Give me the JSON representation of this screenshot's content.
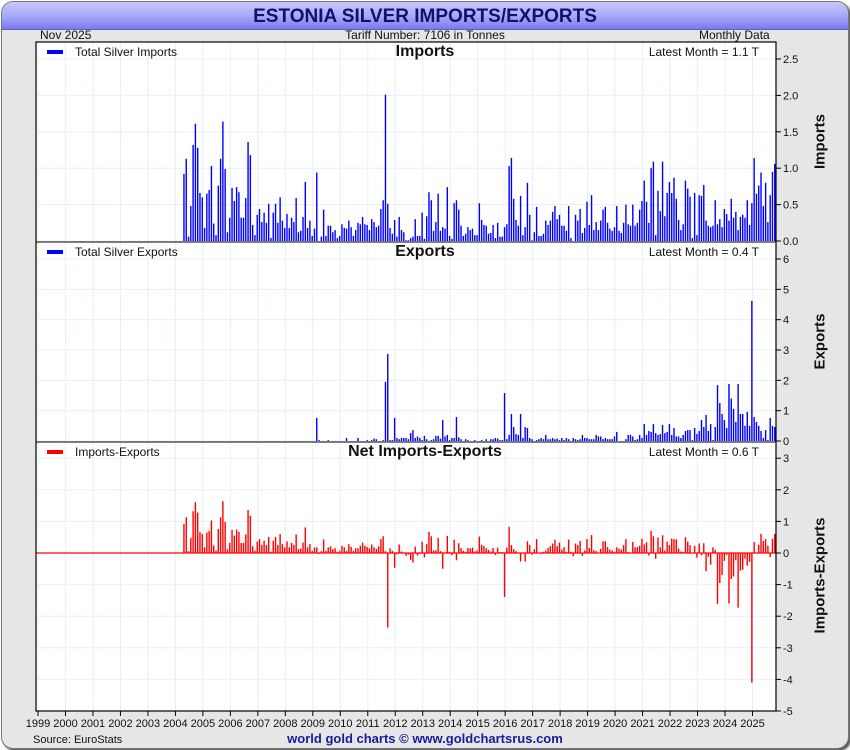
{
  "title": "ESTONIA SILVER IMPORTS/EXPORTS",
  "header": {
    "date": "Nov  2025",
    "tariff": "Tariff Number: 7106 in Tonnes",
    "frequency": "Monthly Data"
  },
  "footer": {
    "source": "Source: EuroStats",
    "brand": "world gold charts © www.goldchartsrus.com"
  },
  "colors": {
    "imports": "#0000ff",
    "exports": "#0000ff",
    "net": "#ff0000",
    "grid": "#e4f0fa"
  },
  "chart_data": {
    "type": "bar",
    "start_month": "2004-05",
    "end_month": "2025-11",
    "x_ticks": [
      "1999",
      "2000",
      "2001",
      "2002",
      "2003",
      "2004",
      "2005",
      "2006",
      "2007",
      "2008",
      "2009",
      "2010",
      "2011",
      "2012",
      "2013",
      "2014",
      "2015",
      "2016",
      "2017",
      "2018",
      "2019",
      "2020",
      "2021",
      "2022",
      "2023",
      "2024",
      "2025"
    ],
    "panels": [
      {
        "key": "imports",
        "title": "Imports",
        "ylabel": "Imports",
        "legend": "Total Silver Imports",
        "latest": "Latest Month = 1.1 T",
        "ylim": [
          0,
          2.5
        ],
        "yticks": [
          "0.0",
          "0.5",
          "1.0",
          "1.5",
          "2.0",
          "2.5"
        ],
        "tick_values": [
          0,
          0.5,
          1,
          1.5,
          2,
          2.5
        ]
      },
      {
        "key": "exports",
        "title": "Exports",
        "ylabel": "Exports",
        "legend": "Total Silver Exports",
        "latest": "Latest Month = 0.4 T",
        "ylim": [
          0,
          6
        ],
        "yticks": [
          "0",
          "1",
          "2",
          "3",
          "4",
          "5",
          "6"
        ],
        "tick_values": [
          0,
          1,
          2,
          3,
          4,
          5,
          6
        ]
      },
      {
        "key": "net",
        "title": "Net Imports-Exports",
        "ylabel": "Imports-Exports",
        "legend": "Imports-Exports",
        "latest": "Latest Month = 0.6 T",
        "ylim": [
          -5,
          3
        ],
        "yticks": [
          "-5",
          "-4",
          "-3",
          "-2",
          "-1",
          "0",
          "1",
          "2",
          "3"
        ],
        "tick_values": [
          -5,
          -4,
          -3,
          -2,
          -1,
          0,
          1,
          2,
          3
        ]
      }
    ],
    "series": {
      "imports": [
        0.92,
        1.13,
        0.06,
        0.48,
        1.32,
        1.61,
        1.28,
        0.66,
        0.6,
        0.18,
        0.65,
        0.7,
        1.03,
        0.24,
        0.08,
        0.76,
        1.13,
        1.64,
        0.99,
        0.12,
        0.32,
        0.73,
        0.55,
        0.74,
        0.67,
        0.32,
        0.32,
        0.59,
        1.36,
        1.18,
        0.22,
        0.08,
        0.36,
        0.44,
        0.26,
        0.39,
        0.25,
        0.51,
        0.04,
        0.39,
        0.51,
        0.25,
        0.6,
        0.28,
        0.18,
        0.37,
        0.18,
        0.32,
        0.26,
        0.59,
        0.12,
        0.14,
        0.33,
        0.81,
        0.18,
        0.28,
        0.07,
        0.17,
        0.94,
        0,
        0.06,
        0.43,
        0.07,
        0.21,
        0.21,
        0.12,
        0.15,
        0.04,
        0.07,
        0.23,
        0.18,
        0.17,
        0.28,
        0.19,
        0.07,
        0.15,
        0.25,
        0.23,
        0.33,
        0.23,
        0.22,
        0.15,
        0.3,
        0.26,
        0.19,
        0.21,
        0.44,
        0.56,
        2.01,
        0.51,
        0.18,
        0.1,
        0.29,
        0.06,
        0.33,
        0.15,
        0.12,
        0.01,
        0.01,
        0.04,
        0.06,
        0.3,
        0.07,
        0.07,
        0.39,
        0.03,
        0.34,
        0.67,
        0.56,
        0.14,
        0.26,
        0.65,
        0.14,
        0.19,
        0.17,
        0.74,
        0.07,
        0.03,
        0.52,
        0.56,
        0.43,
        0.21,
        0.07,
        0.1,
        0.19,
        0.15,
        0.17,
        0.08,
        0.08,
        0.52,
        0.29,
        0.22,
        0.21,
        0.1,
        0.11,
        0.22,
        0.04,
        0.25,
        0.06,
        0.06,
        0.19,
        0.23,
        1.03,
        1.14,
        0.58,
        0.29,
        0.21,
        0.62,
        0.08,
        0.19,
        0.8,
        0.36,
        0.01,
        0.12,
        0.47,
        0.07,
        0.07,
        0.1,
        0.28,
        0.22,
        0.28,
        0.4,
        0.48,
        0.3,
        0.36,
        0.21,
        0.21,
        0.14,
        0.48,
        0.04,
        0,
        0.36,
        0.28,
        0.44,
        0.11,
        0.18,
        0.54,
        0.22,
        0.63,
        0.15,
        0.26,
        0.15,
        0.28,
        0.43,
        0.47,
        0.25,
        0.17,
        0.14,
        0.19,
        0.48,
        0.14,
        0.11,
        0.25,
        0.5,
        0.23,
        0.21,
        0.5,
        0.21,
        0.25,
        0.43,
        0.55,
        0.83,
        0.54,
        0.25,
        1.0,
        1.09,
        0.08,
        0.69,
        0.41,
        1.09,
        0.34,
        0.66,
        0.81,
        0.66,
        0.87,
        0.58,
        0.29,
        0.15,
        0.23,
        0.83,
        0.72,
        0.61,
        0.04,
        0.66,
        0.08,
        0.63,
        0.62,
        0.77,
        0.28,
        0.21,
        0.19,
        0.21,
        0.56,
        0.23,
        0.3,
        0.19,
        0.44,
        0.37,
        0.28,
        0.58,
        0.32,
        0.4,
        0.15,
        0.33,
        0.36,
        0.32,
        0.56,
        0.22,
        0.52,
        1.14,
        0.65,
        0.76,
        0.94,
        0.48,
        0.8,
        0.26,
        0.63,
        0.95,
        1.06
      ],
      "exports": [
        0,
        0,
        0,
        0,
        0,
        0,
        0,
        0,
        0,
        0,
        0,
        0,
        0,
        0,
        0,
        0,
        0,
        0,
        0,
        0,
        0,
        0,
        0,
        0,
        0,
        0,
        0,
        0,
        0,
        0,
        0,
        0,
        0,
        0,
        0,
        0,
        0,
        0,
        0,
        0,
        0,
        0,
        0,
        0,
        0,
        0,
        0,
        0,
        0,
        0,
        0,
        0,
        0,
        0,
        0,
        0,
        0,
        0,
        0.76,
        0.03,
        0,
        0,
        0,
        0.03,
        0,
        0,
        0,
        0,
        0,
        0,
        0,
        0.1,
        0,
        0,
        0,
        0,
        0.1,
        0,
        0,
        0,
        0.03,
        0,
        0.03,
        0.08,
        0.06,
        0,
        0,
        0.03,
        1.95,
        2.87,
        0.03,
        0.03,
        0.76,
        0.1,
        0.06,
        0.1,
        0.1,
        0.1,
        0.06,
        0.26,
        0.36,
        0.1,
        0.15,
        0.1,
        0.03,
        0.17,
        0.06,
        0,
        0.03,
        0.06,
        0.17,
        0.17,
        0.08,
        0.69,
        0.15,
        0.2,
        0.03,
        0.1,
        0.1,
        0.79,
        0.12,
        0.06,
        0,
        0.06,
        0.03,
        0,
        0,
        0.03,
        0,
        0,
        0.03,
        0,
        0.06,
        0,
        0.06,
        0.06,
        0.1,
        0.08,
        0.03,
        0.03,
        1.58,
        0.06,
        0.2,
        0.89,
        0.46,
        0.23,
        0.2,
        0.89,
        0.1,
        0.46,
        0.43,
        0.1,
        0.06,
        0,
        0.03,
        0.06,
        0.1,
        0.06,
        0.2,
        0.06,
        0.06,
        0.1,
        0.06,
        0.08,
        0.03,
        0.1,
        0.03,
        0.1,
        0.06,
        0,
        0.1,
        0.06,
        0.03,
        0.06,
        0.2,
        0.1,
        0.1,
        0.06,
        0.06,
        0.06,
        0.2,
        0.15,
        0.15,
        0.06,
        0.1,
        0.06,
        0.06,
        0.06,
        0.15,
        0.3,
        0,
        0,
        0,
        0.06,
        0.2,
        0.2,
        0.15,
        0.03,
        0.06,
        0.2,
        0.1,
        0.56,
        0.2,
        0.33,
        0.3,
        0.56,
        0.26,
        0.2,
        0.23,
        0.53,
        0.26,
        0.3,
        0.56,
        0.2,
        0.43,
        0.15,
        0.15,
        0.1,
        0.2,
        0.33,
        0.36,
        0.36,
        0.03,
        0.43,
        0.23,
        0.33,
        0.69,
        0.46,
        0.86,
        0.33,
        0.56,
        0.03,
        0.46,
        1.84,
        1.25,
        0.89,
        0.69,
        0.43,
        1.88,
        1.4,
        1.06,
        0.63,
        1.88,
        0.89,
        0.89,
        0.5,
        0.96,
        0.5,
        4.62,
        0.79,
        0.63,
        0.5,
        0.33,
        0.1,
        0.36,
        0.03,
        0.76,
        0.5,
        0.46
      ]
    }
  }
}
